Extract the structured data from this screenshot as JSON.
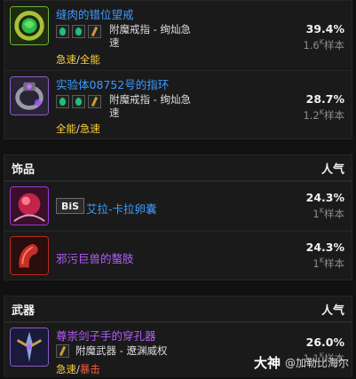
{
  "rings": {
    "items": [
      {
        "name": "缝肉的错位望戒",
        "enchant": "附魔戒指 - 绚灿急速",
        "stats_a": "急速",
        "stats_sep": "/",
        "stats_b": "全能",
        "percent": "39.4%",
        "count_num": "1.6",
        "count_sup": "K",
        "count_unit": "样本"
      },
      {
        "name": "实验体08752号的指环",
        "enchant": "附魔戒指 - 绚灿急速",
        "stats_a": "全能",
        "stats_sep": "/",
        "stats_b": "急速",
        "percent": "28.7%",
        "count_num": "1.2",
        "count_sup": "K",
        "count_unit": "样本"
      }
    ]
  },
  "trinkets": {
    "title": "饰品",
    "pop_label": "人气",
    "items": [
      {
        "badge": "BiS",
        "name": "艾拉-卡拉卵囊",
        "percent": "24.3%",
        "count_num": "1",
        "count_sup": "K",
        "count_unit": "样本"
      },
      {
        "name": "邪污巨兽的螯肢",
        "percent": "24.3%",
        "count_num": "1",
        "count_sup": "K",
        "count_unit": "样本"
      }
    ]
  },
  "weapons": {
    "title": "武器",
    "pop_label": "人气",
    "items": [
      {
        "name": "尊崇剑子手的穿孔器",
        "enchant": "附魔武器 - 遼渊威权",
        "stats_a": "急速",
        "stats_sep": "/",
        "stats_b": "暴击",
        "percent": "26.0%",
        "count_num": "1.1",
        "count_sup": "K",
        "count_unit": "样本"
      }
    ]
  },
  "watermark": {
    "logo": "大神",
    "handle": "@加勒比海尔"
  },
  "colors": {
    "name_blue": "#3d9bff",
    "name_purple": "#b35cff",
    "stat_yellow": "#ffd23a",
    "stat_red": "#ff5a3a",
    "gem_green": "#20c07a"
  }
}
